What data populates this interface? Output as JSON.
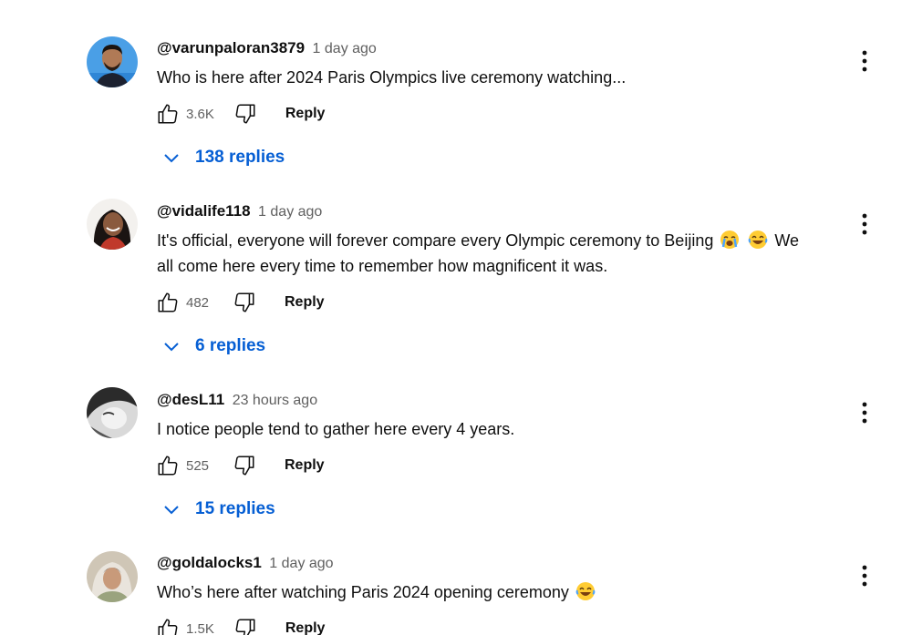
{
  "comments": [
    {
      "author": "@varunpaloran3879",
      "time": "1 day ago",
      "text_lines": [
        "Who is here after 2024 Paris Olympics live ceremony watching..."
      ],
      "likes": "3.6K",
      "reply_label": "Reply",
      "replies_label": "138 replies"
    },
    {
      "author": "@vidalife118",
      "time": "1 day ago",
      "text_part1": "It's official, everyone will forever compare every Olympic ceremony to Beijing",
      "text_part2": "We",
      "text_line2": "all come here every time to remember how magnificent it was.",
      "likes": "482",
      "reply_label": "Reply",
      "replies_label": "6 replies"
    },
    {
      "author": "@desL11",
      "time": "23 hours ago",
      "text_lines": [
        "I notice people tend to gather here every 4 years."
      ],
      "likes": "525",
      "reply_label": "Reply",
      "replies_label": "15 replies"
    },
    {
      "author": "@goldalocks1",
      "time": "1 day ago",
      "text_lines": [
        "Who’s here after watching Paris 2024 opening ceremony"
      ],
      "likes": "1.5K",
      "reply_label": "Reply"
    }
  ],
  "icons": {
    "like": "thumbs-up-icon",
    "dislike": "thumbs-down-icon",
    "more": "more-vert-icon",
    "expand": "chevron-down-icon",
    "emoji_crying": "loudly-crying-face-emoji",
    "emoji_laughing": "tears-of-joy-emoji"
  },
  "colors": {
    "link_blue": "#065fd4",
    "secondary_text": "#606060",
    "primary_text": "#0f0f0f"
  }
}
